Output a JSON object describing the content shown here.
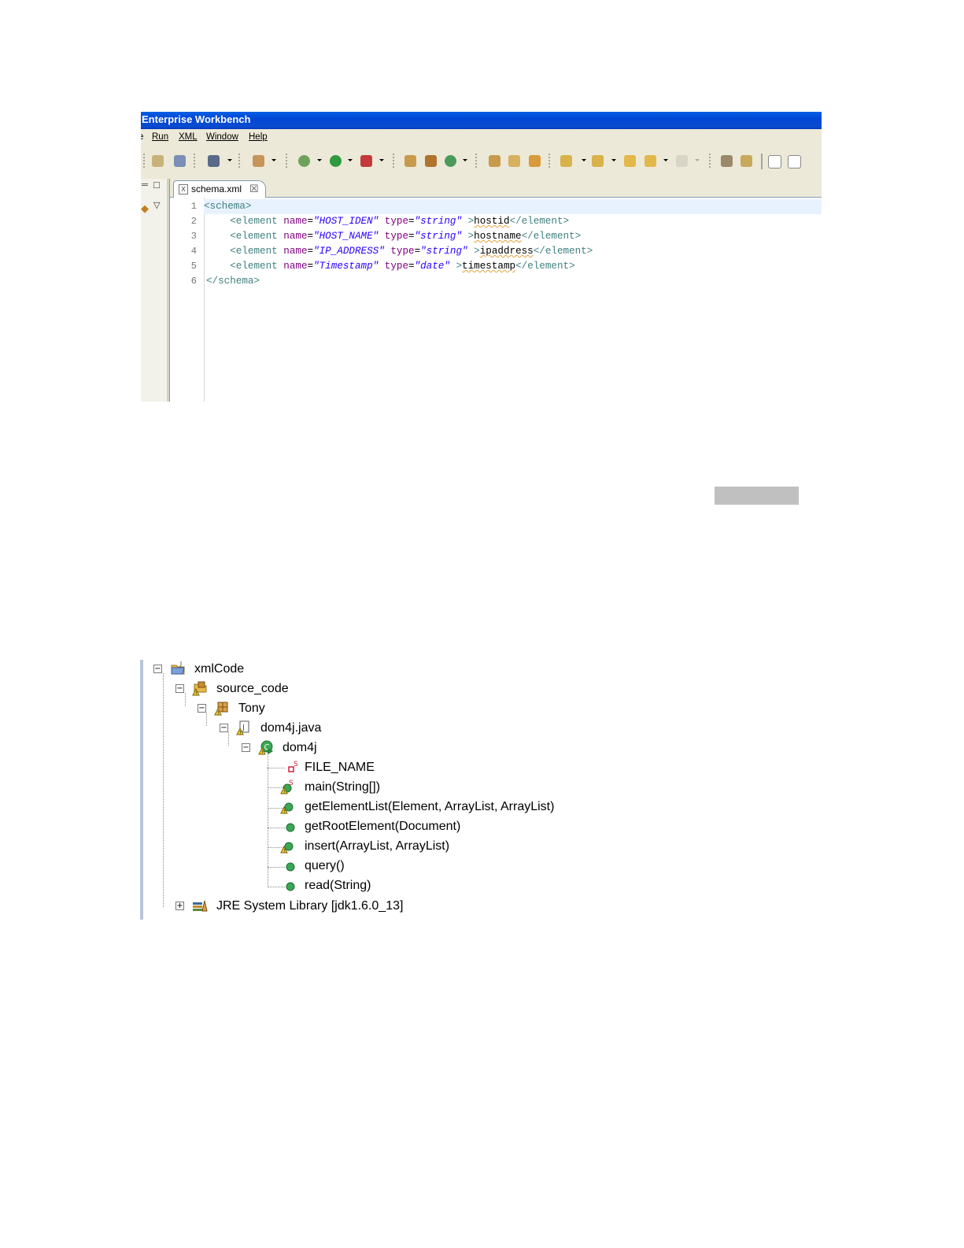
{
  "window": {
    "title": "Enterprise Workbench"
  },
  "menu": [
    "e",
    "Run",
    "XML",
    "Window",
    "Help"
  ],
  "editor": {
    "tab_title": "schema.xml",
    "tab_icon": "xml-file-icon",
    "line_numbers": [
      "1",
      "2",
      "3",
      "4",
      "5",
      "6"
    ],
    "lines": [
      {
        "indent": "",
        "open": "<schema>"
      },
      {
        "indent": "    ",
        "tag": "<element",
        "a1": "name",
        "v1": "\"HOST_IDEN\"",
        "a2": "type",
        "v2": "\"string\"",
        "close": ">",
        "text": "hostid",
        "end": "</element>"
      },
      {
        "indent": "    ",
        "tag": "<element",
        "a1": "name",
        "v1": "\"HOST_NAME\"",
        "a2": "type",
        "v2": "\"string\"",
        "close": ">",
        "text": "hostname",
        "end": "</element>"
      },
      {
        "indent": "    ",
        "tag": "<element",
        "a1": "name",
        "v1": "\"IP_ADDRESS\"",
        "a2": "type",
        "v2": "\"string\"",
        "close": ">",
        "text": "ipaddress",
        "end": "</element>"
      },
      {
        "indent": "    ",
        "tag": "<element",
        "a1": "name",
        "v1": "\"Timestamp\"",
        "a2": "type",
        "v2": "\"date\"",
        "close": ">",
        "text": "timestamp",
        "end": "</element>"
      },
      {
        "indent": "",
        "open": "</schema>"
      }
    ]
  },
  "tree": {
    "project": "xmlCode",
    "source_folder": "source_code",
    "package": "Tony",
    "file": "dom4j.java",
    "class": "dom4j",
    "members": [
      "FILE_NAME",
      "main(String[])",
      "getElementList(Element, ArrayList, ArrayList)",
      "getRootElement(Document)",
      "insert(ArrayList, ArrayList)",
      "query()",
      "read(String)"
    ],
    "library": "JRE System Library [jdk1.6.0_13]"
  },
  "colors": {
    "title_bar": "#0046d5",
    "tag": "#3f7f7f",
    "attribute": "#7f007f",
    "string": "#2a00ff",
    "method_green": "#3aa757",
    "field_red": "#d0203a"
  }
}
